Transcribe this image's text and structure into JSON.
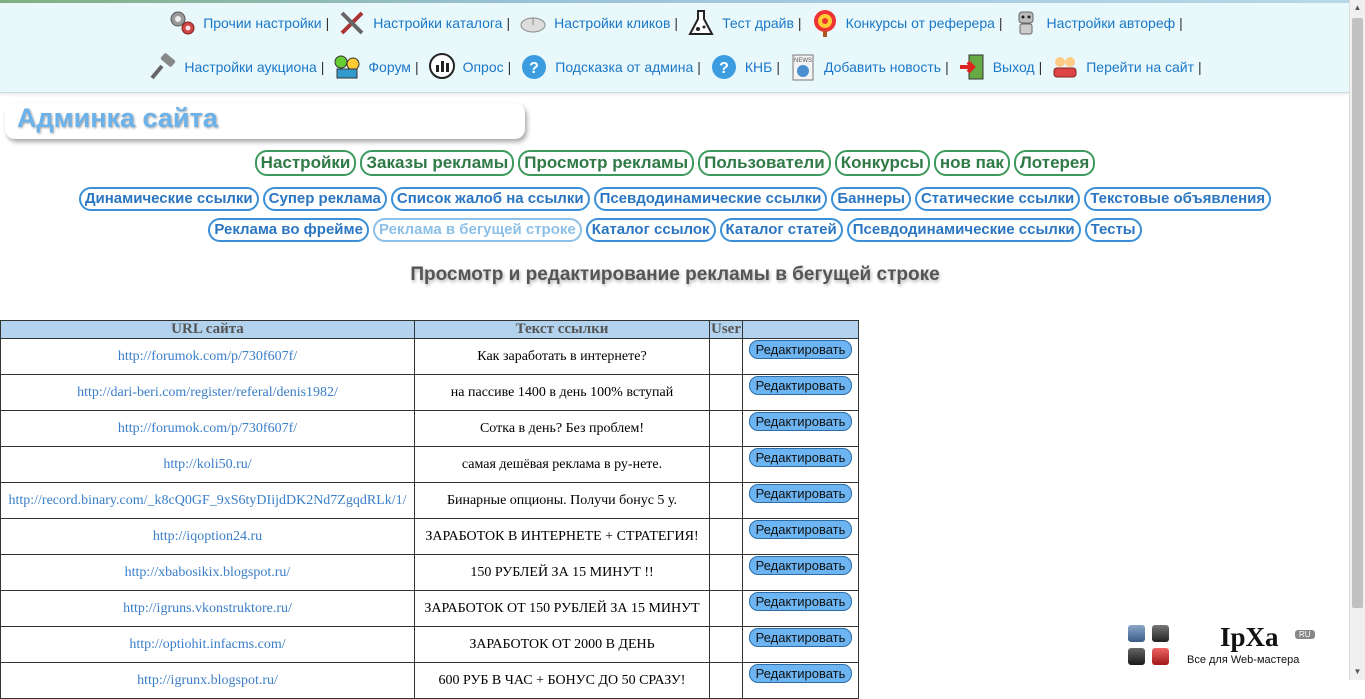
{
  "topnav": {
    "row1": [
      {
        "label": "Прочии настройки",
        "icon": "gears-icon"
      },
      {
        "label": "Настройки каталога",
        "icon": "tools-icon"
      },
      {
        "label": "Настройки кликов",
        "icon": "mouse-icon"
      },
      {
        "label": "Тест драйв",
        "icon": "flask-icon"
      },
      {
        "label": "Конкурсы от реферера",
        "icon": "target-icon"
      },
      {
        "label": "Настройки автореф",
        "icon": "robot-icon"
      }
    ],
    "row2": [
      {
        "label": "Настройки аукциона",
        "icon": "gavel-icon"
      },
      {
        "label": "Форум",
        "icon": "forum-icon"
      },
      {
        "label": "Опрос",
        "icon": "poll-icon"
      },
      {
        "label": "Подсказка от админа",
        "icon": "help-icon"
      },
      {
        "label": "КНБ",
        "icon": "help-icon"
      },
      {
        "label": "Добавить новость",
        "icon": "news-icon"
      },
      {
        "label": "Выход",
        "icon": "exit-icon"
      },
      {
        "label": "Перейти на сайт",
        "icon": "site-icon"
      }
    ],
    "separator": "|"
  },
  "page_title": "Админка сайта",
  "menu_main": [
    "Настройки",
    "Заказы рекламы",
    "Просмотр рекламы",
    "Пользователи",
    "Конкурсы",
    "нов пак",
    "Лотерея"
  ],
  "menu_sub_row1": [
    "Динамические ссылки",
    "Супер реклама",
    "Список жалоб на ссылки",
    "Псевдодинамические ссылки",
    "Баннеры",
    "Статические ссылки",
    "Текстовые объявления"
  ],
  "menu_sub_row2": [
    "Реклама во фрейме",
    "Реклама в бегущей строке",
    "Каталог ссылок",
    "Каталог статей",
    "Псевдодинамические ссылки",
    "Тесты"
  ],
  "menu_sub_active": "Реклама в бегущей строке",
  "heading": "Просмотр и редактирование рекламы в бегущей строке",
  "table": {
    "headers": [
      "URL сайта",
      "Текст ссылки",
      "User",
      ""
    ],
    "edit_label": "Редактировать",
    "rows": [
      {
        "url": "http://forumok.com/p/730f607f/",
        "text": "Как заработать в интернете?",
        "user": ""
      },
      {
        "url": "http://dari-beri.com/register/referal/denis1982/",
        "text": "на пассиве 1400 в день 100% вступай",
        "user": ""
      },
      {
        "url": "http://forumok.com/p/730f607f/",
        "text": "Сотка в день? Без проблем!",
        "user": ""
      },
      {
        "url": "http://koli50.ru/",
        "text": "самая дешёвая реклама в ру-нете.",
        "user": ""
      },
      {
        "url": "http://record.binary.com/_k8cQ0GF_9xS6tyDIijdDK2Nd7ZgqdRLk/1/",
        "text": "Бинарные опционы. Получи бонус 5 у.",
        "user": ""
      },
      {
        "url": "http://iqoption24.ru",
        "text": "ЗАРАБОТОК В ИНТЕРНЕТЕ + СТРАТЕГИЯ!",
        "user": ""
      },
      {
        "url": "http://xbabosikix.blogspot.ru/",
        "text": "150 РУБЛЕЙ ЗА 15 МИНУТ !!",
        "user": ""
      },
      {
        "url": "http://igruns.vkonstruktore.ru/",
        "text": "ЗАРАБОТОК ОТ 150 РУБЛЕЙ ЗА 15 МИНУТ",
        "user": ""
      },
      {
        "url": "http://optiohit.infacms.com/",
        "text": "ЗАРАБОТОК ОТ 2000 В ДЕНЬ",
        "user": ""
      },
      {
        "url": "http://igrunx.blogspot.ru/",
        "text": "600 РУБ В ЧАС + БОНУС ДО 50 СРАЗУ!",
        "user": ""
      }
    ]
  },
  "logo": {
    "brand": "IpXa",
    "badge": "RU",
    "subtitle": "Все для Web-мастера"
  }
}
